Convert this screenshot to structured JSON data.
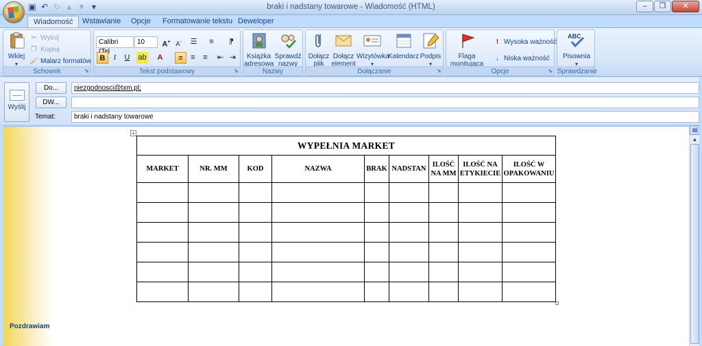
{
  "window": {
    "title": "braki i nadstany towarowe - Wiadomość (HTML)",
    "controls": [
      "–",
      "❐",
      "✕"
    ]
  },
  "quick_access": [
    "save-icon",
    "undo-icon",
    "redo-icon",
    "forward-icon",
    "customize-icon"
  ],
  "tabs": [
    {
      "label": "Wiadomość",
      "active": true
    },
    {
      "label": "Wstawianie"
    },
    {
      "label": "Opcje"
    },
    {
      "label": "Formatowanie tekstu"
    },
    {
      "label": "Deweloper"
    }
  ],
  "ribbon": {
    "clipboard": {
      "label": "Schowek",
      "paste": "Wklej",
      "cut": "Wytnij",
      "copy": "Kopiuj",
      "painter": "Malarz formatów"
    },
    "basic_text": {
      "label": "Tekst podstawowy",
      "font": "Calibri (Tel",
      "size": "10"
    },
    "names": {
      "label": "Nazwy",
      "address_book": "Książka adresowa",
      "check_names": "Sprawdź nazwy"
    },
    "include": {
      "label": "Dołączanie",
      "attach_file": "Dołącz plik",
      "attach_item": "Dołącz element",
      "business_card": "Wizytówka",
      "calendar": "Kalendarz",
      "signature": "Podpis"
    },
    "options": {
      "label": "Opcje",
      "follow_up": "Flaga monitująca",
      "high_importance": "Wysoka ważność",
      "low_importance": "Niska ważność"
    },
    "proofing": {
      "label": "Sprawdzanie",
      "spelling": "Pisownia"
    }
  },
  "header": {
    "send_label": "Wyślij",
    "to_button": "Do...",
    "cc_button": "DW...",
    "subject_label": "Temat:",
    "to_value": "niezgodnosci@txm.pl;",
    "cc_value": "",
    "subject_value": "braki i nadstany towarowe"
  },
  "message": {
    "table_title": "WYPEŁNIA MARKET",
    "columns": [
      "MARKET",
      "NR. MM",
      "KOD",
      "NAZWA",
      "BRAK",
      "NADSTAN",
      "ILOŚĆ NA MM",
      "ILOŚĆ NA ETYKIECIE",
      "ILOŚĆ W OPAKOWANIU"
    ],
    "empty_rows": 6,
    "closing": "Pozdrawiam"
  }
}
